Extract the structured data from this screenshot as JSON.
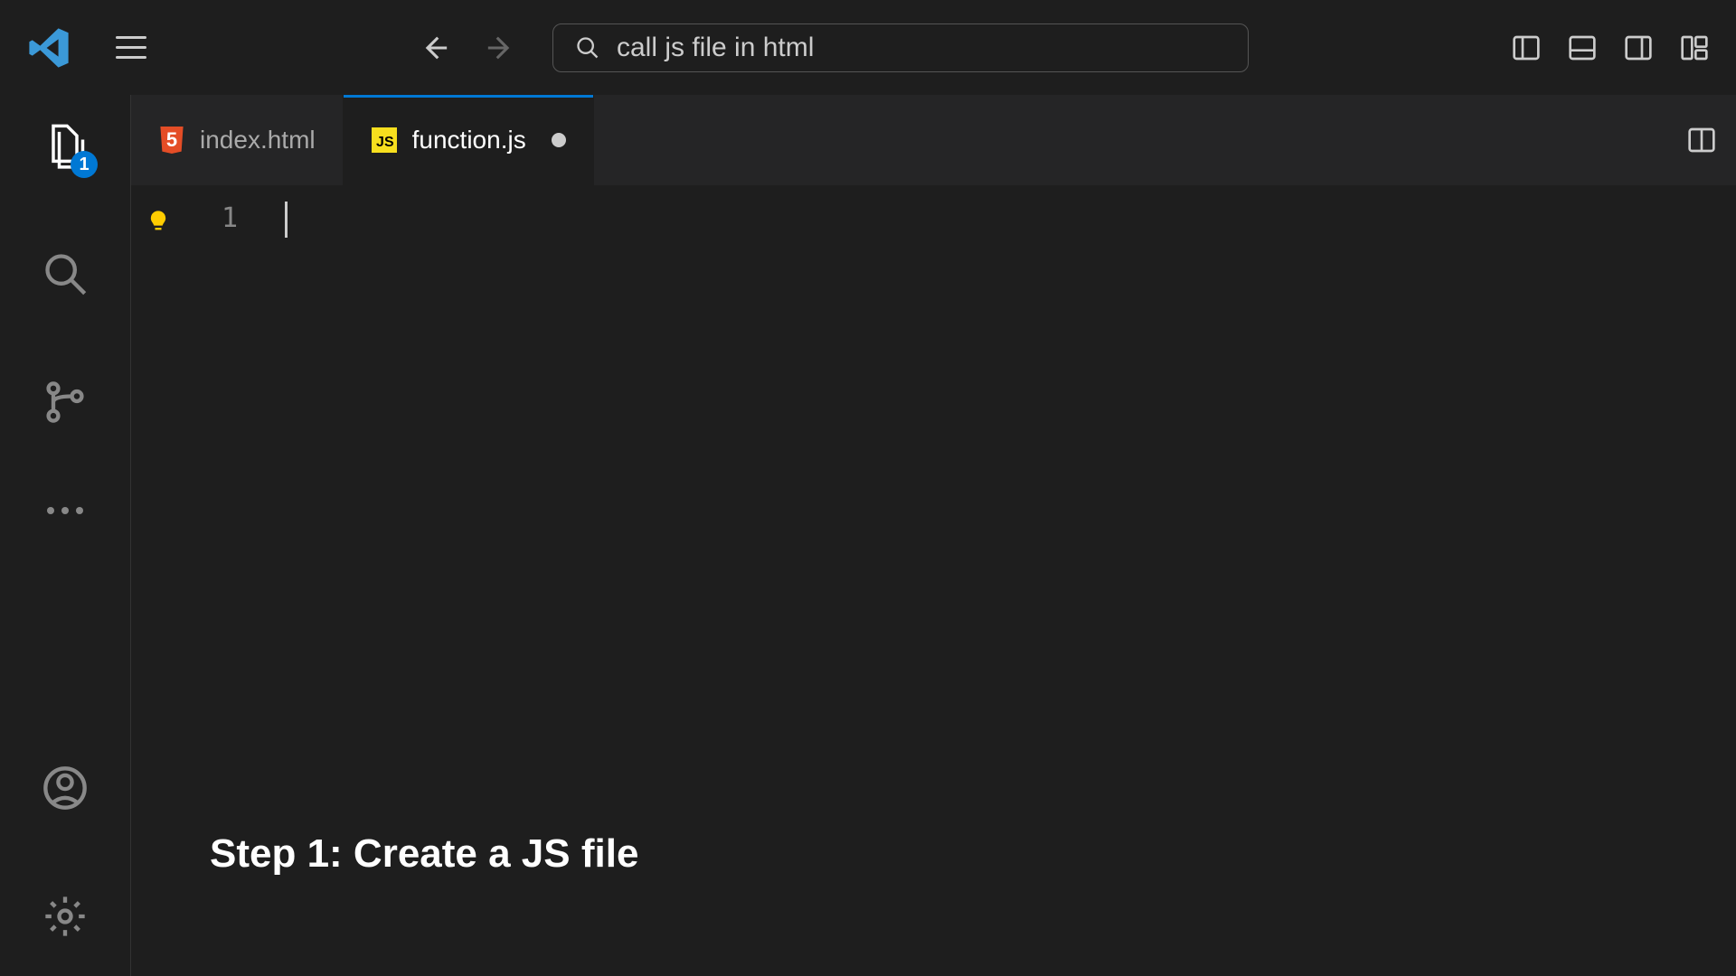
{
  "titlebar": {
    "search_text": "call js file in html"
  },
  "activitybar": {
    "explorer_badge": "1"
  },
  "tabs": [
    {
      "label": "index.html",
      "icon": "html5",
      "active": false,
      "dirty": false
    },
    {
      "label": "function.js",
      "icon": "js",
      "active": true,
      "dirty": true
    }
  ],
  "editor": {
    "line_number": "1"
  },
  "caption": "Step 1: Create a JS file"
}
